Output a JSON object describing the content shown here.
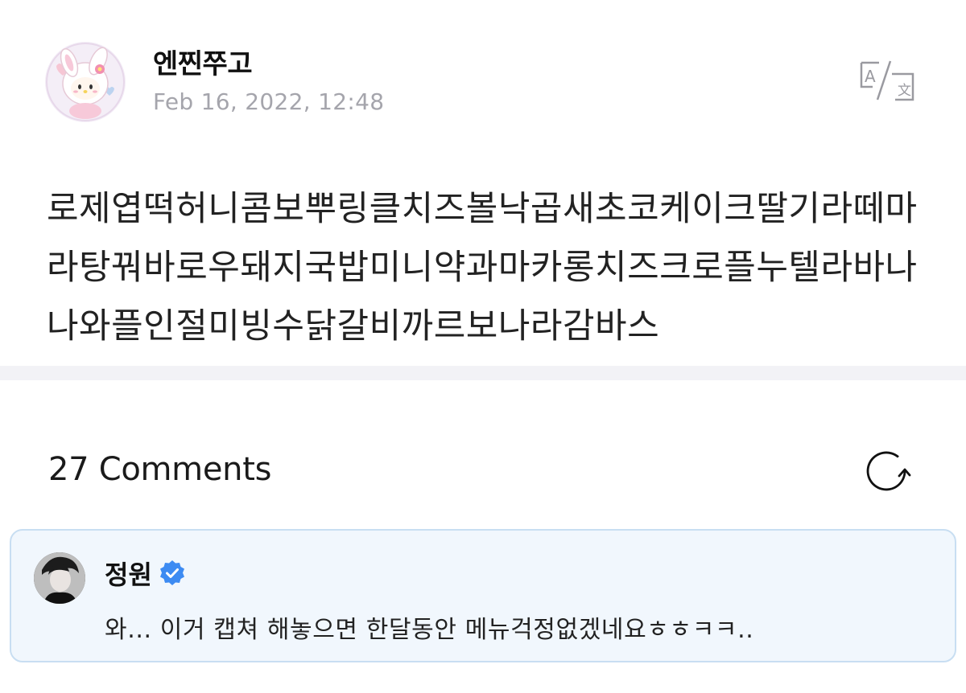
{
  "post": {
    "author": "엔찐쭈고",
    "date": "Feb 16, 2022, 12:48",
    "avatar_icon": "my-melody-avatar",
    "translate_icon": "translate-icon",
    "body": "로제엽떡허니콤보뿌링클치즈볼낙곱새초코케이크딸기라떼마라탕꿔바로우돼지국밥미니약과마카롱치즈크로플누텔라바나나와플인절미빙수닭갈비까르보나라감바스"
  },
  "comments": {
    "count_label": "27 Comments",
    "refresh_icon": "refresh-icon",
    "items": [
      {
        "author": "정원",
        "verified": true,
        "text": "와... 이거 캡쳐 해놓으면 한달동안 메뉴걱정없겠네요ㅎㅎㅋㅋ..",
        "highlight_bg": "#f1f7fd",
        "badge_color": "#3d8bf2"
      }
    ]
  }
}
